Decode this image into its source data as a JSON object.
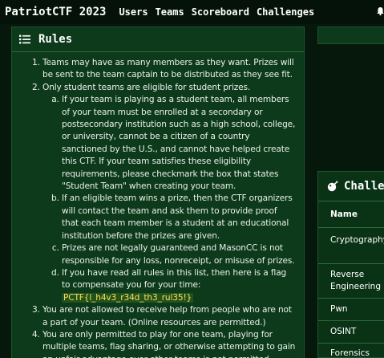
{
  "navbar": {
    "brand": "PatriotCTF 2023",
    "links": [
      "Users",
      "Teams",
      "Scoreboard",
      "Challenges"
    ],
    "bell_icon": "bell-icon"
  },
  "rules": {
    "title": "Rules",
    "icon": "list-icon",
    "items": [
      "Teams may have as many members as they want. Prizes will be sent to the team captain to be distributed as they see fit.",
      "Only student teams are eligible for student prizes.",
      "You are not allowed to receive help from people who are not a part of your team. (Online resources are permitted.)",
      "You are only permitted to play for one team, playing for multiple teams, flag sharing, or otherwise attempting to gain an unfair advantage over other teams is not permitted."
    ],
    "sub_items": [
      "If your team is playing as a student team, all members of your team must be enrolled at a secondary or postsecondary institution such as a high school, college, or university, cannot be a citizen of a country sanctioned by the U.S., and cannot have helped create this CTF. If your team satisfies these eligibility requirements, please checkmark the box that states \"Student Team\" when creating your team.",
      "If an eligible team wins a prize, then the CTF organizers will contact the team and ask them to provide proof that each team member is a student at an educational institution before the prizes are given.",
      "Prizes are not legally guaranteed and MasonCC is not responsible for any loss, nonreceipt, or misuse of prizes.",
      "If you have read all rules in this list, then here is a flag to compensate you for your time:"
    ],
    "flag": "PCTF{l_h4v3_r34d_th3_rul35!}"
  },
  "challenges_panel": {
    "title": "Challe",
    "icon": "bomb-icon",
    "column_header": "Name",
    "categories": [
      "Cryptography",
      "Reverse Engineering",
      "Pwn",
      "OSINT",
      "Forensics"
    ]
  }
}
